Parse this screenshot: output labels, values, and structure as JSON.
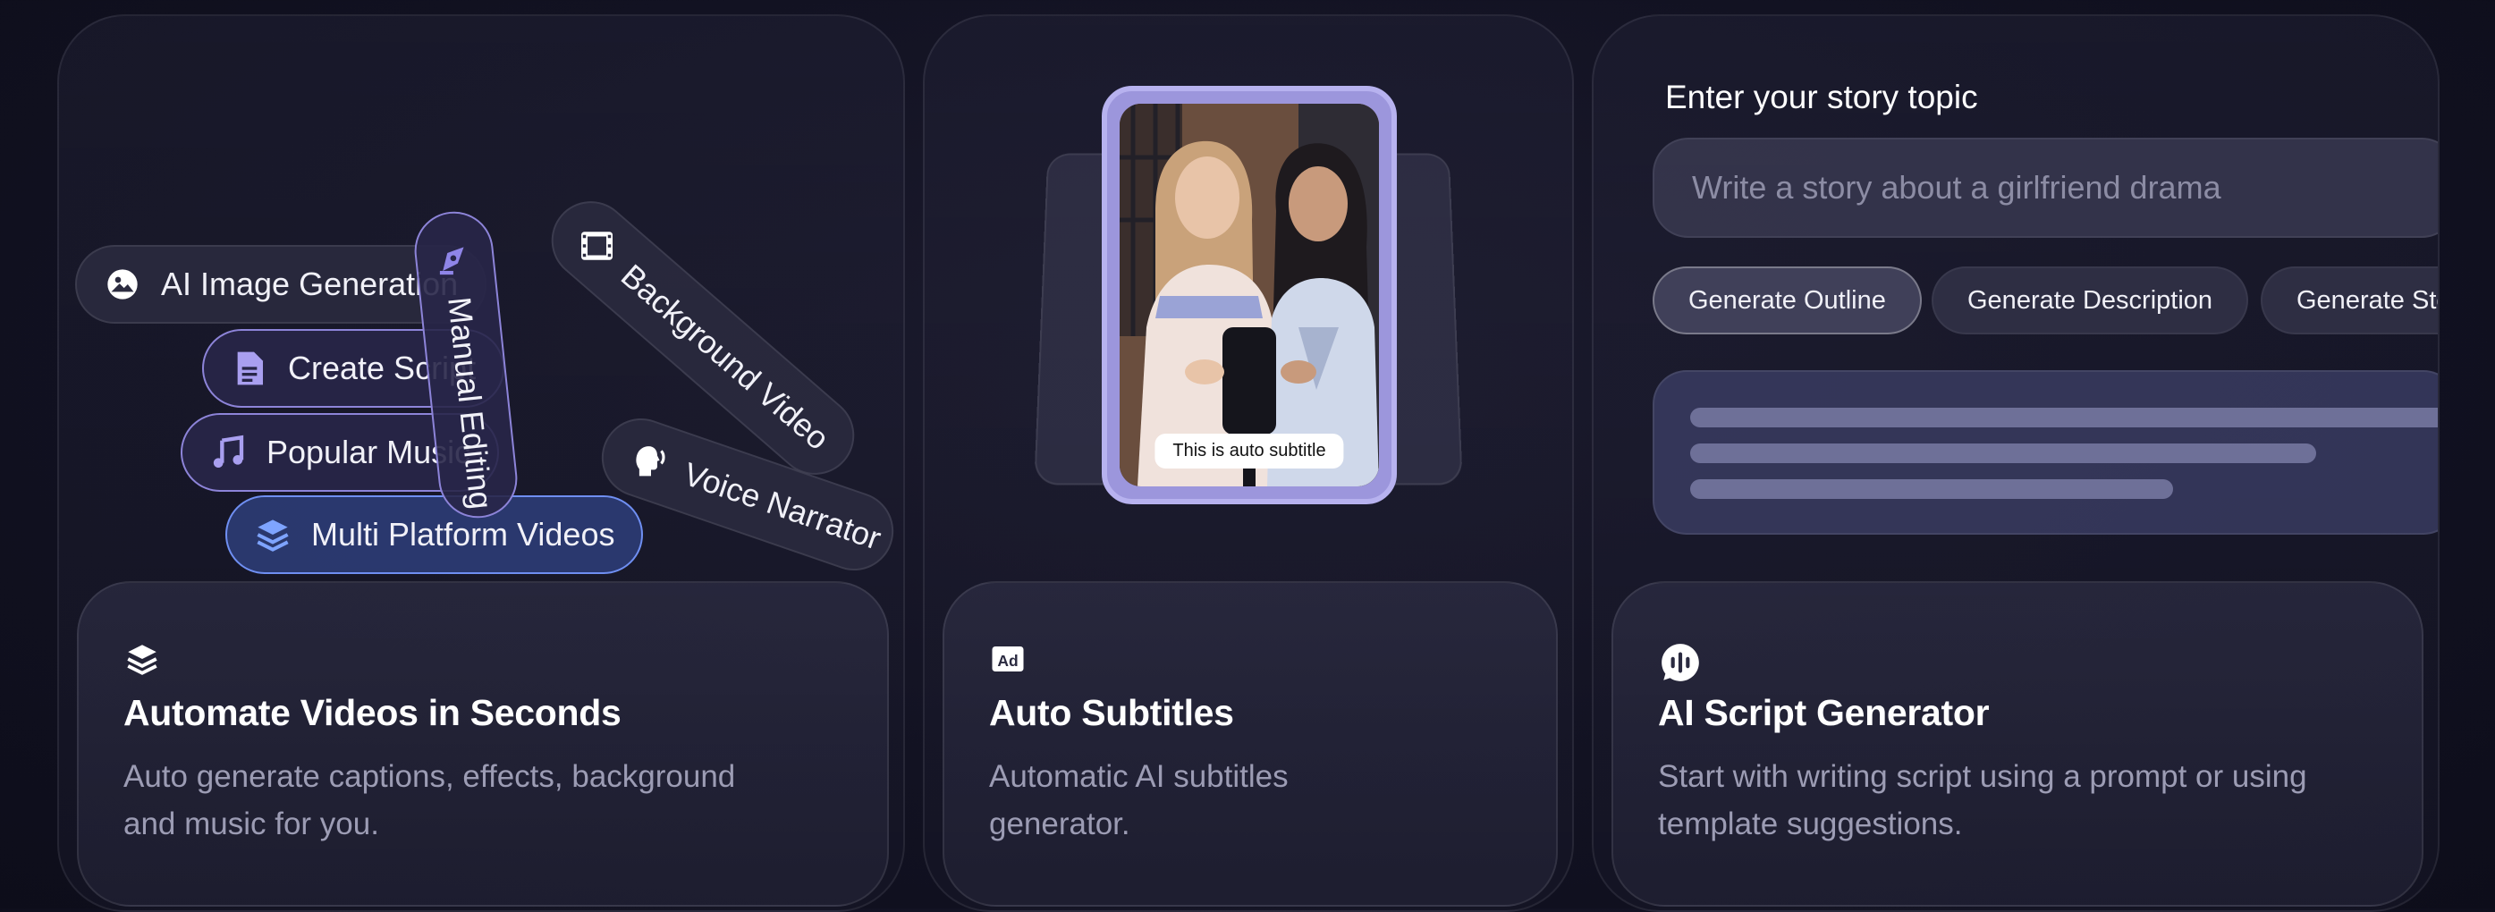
{
  "features_left": {
    "pills": [
      {
        "label": "AI Image Generation",
        "icon": "image-icon"
      },
      {
        "label": "Create Script",
        "icon": "document-icon"
      },
      {
        "label": "Popular Music",
        "icon": "music-note-icon"
      },
      {
        "label": "Multi Platform Videos",
        "icon": "layers-icon"
      },
      {
        "label": "Manual Editing",
        "icon": "pen-tool-icon"
      },
      {
        "label": "Background Video",
        "icon": "film-icon"
      },
      {
        "label": "Voice Narrator",
        "icon": "speaking-head-icon"
      }
    ],
    "title": "Automate Videos in Seconds",
    "description_line1": "Auto generate captions, effects, background",
    "description_line2": "and music for you.",
    "icon": "layers-icon"
  },
  "subtitles": {
    "subtitle_text": "This is auto subtitle",
    "title": "Auto Subtitles",
    "description_line1": "Automatic AI subtitles",
    "description_line2": "generator.",
    "icon": "ad-icon"
  },
  "script_generator": {
    "topic_label": "Enter your story topic",
    "topic_placeholder": "Write a story about a girlfriend drama",
    "buttons": [
      "Generate Outline",
      "Generate Description",
      "Generate Story"
    ],
    "title": "AI Script Generator",
    "description_line1": "Start with writing script using a prompt or using",
    "description_line2": "template suggestions.",
    "icon": "voice-wave-icon"
  },
  "colors": {
    "background": "#121222",
    "accent_purple": "#8d84d9",
    "accent_blue": "#6f8ff2",
    "muted_text": "#9c9cb4"
  }
}
